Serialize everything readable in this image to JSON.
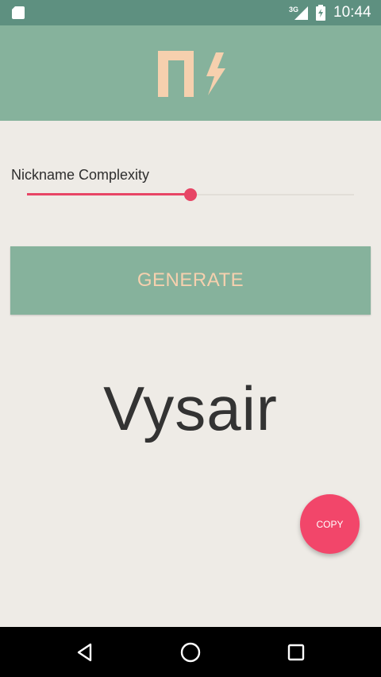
{
  "status_bar": {
    "time": "10:44",
    "network": "3G",
    "icons": [
      "sd-card-icon",
      "signal-icon",
      "battery-icon"
    ]
  },
  "app_bar": {
    "logo_icon": "app-logo-icon",
    "color": "#86B29C"
  },
  "slider": {
    "label": "Nickname Complexity",
    "value_percent": 50,
    "accent_color": "#E74565"
  },
  "generate_button": {
    "label": "GENERATE",
    "text_color": "#F6D0AE"
  },
  "nickname": {
    "value": "Vysair"
  },
  "copy_fab": {
    "label": "COPY",
    "color": "#F2466A"
  },
  "nav_bar": {
    "icons": [
      "back-icon",
      "home-icon",
      "recents-icon"
    ]
  }
}
